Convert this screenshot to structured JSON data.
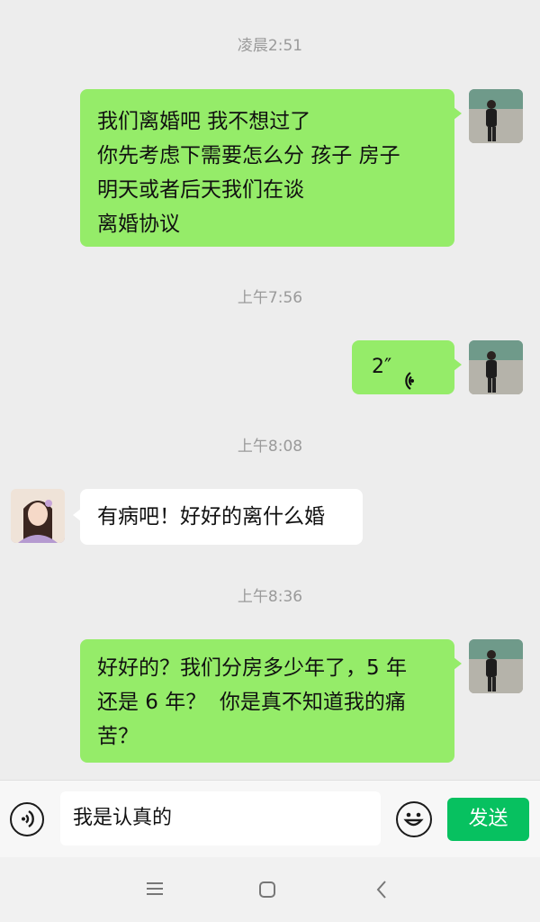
{
  "messages": [
    {
      "time": "凌晨2:51",
      "text": "我们离婚吧 我不想过了\n你先考虑下需要怎么分 孩子 房子\n明天或者后天我们在谈\n离婚协议"
    },
    {
      "time": "上午7:56",
      "voice_duration": "2″"
    },
    {
      "time": "上午8:08",
      "text": "有病吧！好好的离什么婚"
    },
    {
      "time": "上午8:36",
      "text": "好好的？我们分房多少年了，5 年\n还是 6 年？  你是真不知道我的痛\n苦？"
    }
  ],
  "input": {
    "value": "我是认真的"
  },
  "send_label": "发送",
  "colors": {
    "outgoing_bubble": "#95ec69",
    "incoming_bubble": "#ffffff",
    "send_button": "#07c160",
    "background": "#ededed"
  },
  "icons": [
    "voice-input-icon",
    "emoji-icon",
    "menu-icon",
    "home-icon",
    "back-icon",
    "voice-wave-icon"
  ]
}
